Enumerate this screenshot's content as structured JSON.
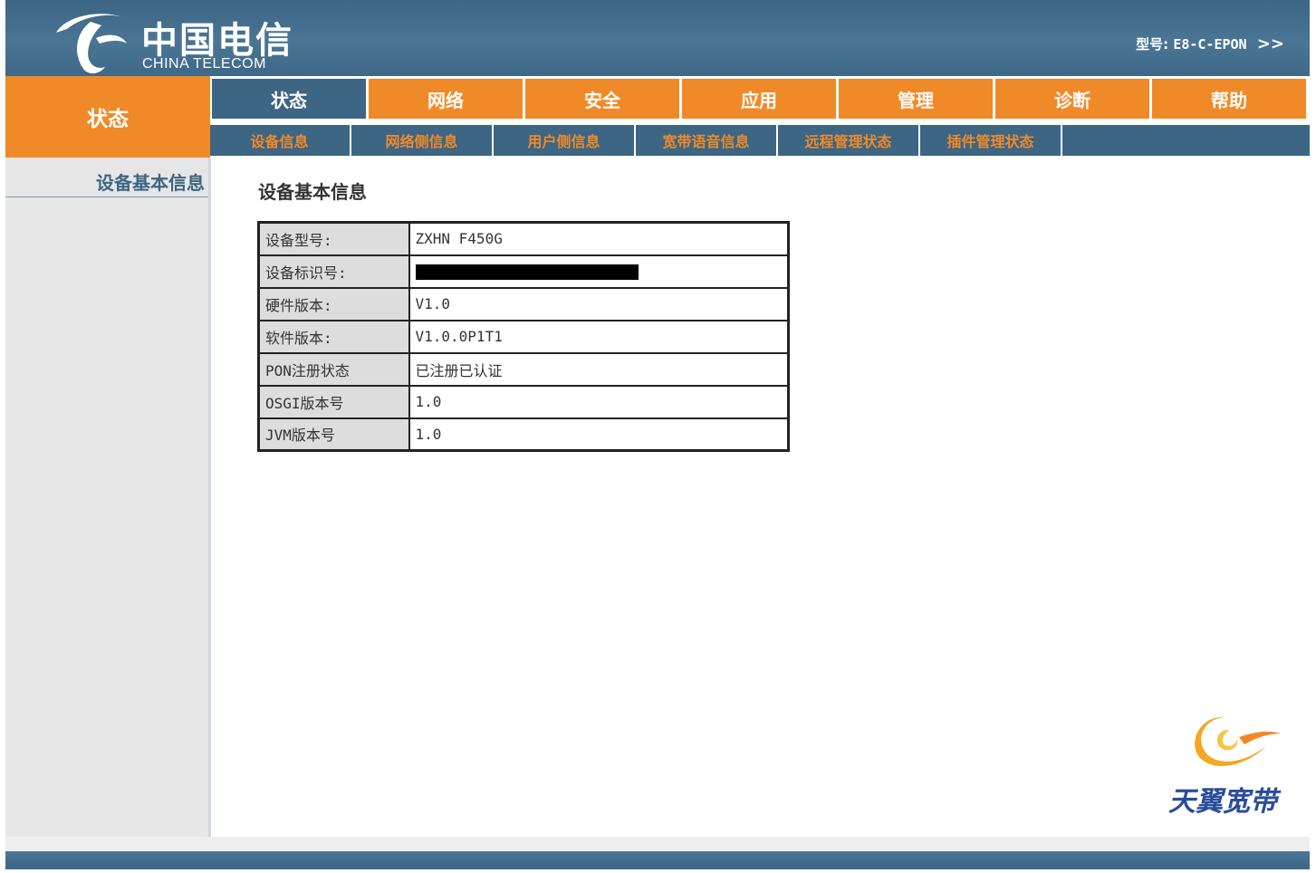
{
  "header": {
    "logo_cn": "中国电信",
    "logo_en": "CHINA TELECOM",
    "model_label": "型号:",
    "model_value": "E8-C-EPON",
    "model_arrow": ">>"
  },
  "section_title": "状态",
  "main_nav": [
    {
      "label": "状态",
      "active": true
    },
    {
      "label": "网络"
    },
    {
      "label": "安全"
    },
    {
      "label": "应用"
    },
    {
      "label": "管理"
    },
    {
      "label": "诊断"
    },
    {
      "label": "帮助"
    }
  ],
  "sub_nav": [
    {
      "label": "设备信息"
    },
    {
      "label": "网络侧信息"
    },
    {
      "label": "用户侧信息"
    },
    {
      "label": "宽带语音信息"
    },
    {
      "label": "远程管理状态"
    },
    {
      "label": "插件管理状态"
    }
  ],
  "sidebar": {
    "items": [
      {
        "label": "设备基本信息"
      }
    ]
  },
  "main": {
    "title": "设备基本信息",
    "rows": [
      {
        "key": "设备型号:",
        "value": "ZXHN F450G"
      },
      {
        "key": "设备标识号:",
        "value": "",
        "redacted": true
      },
      {
        "key": "硬件版本:",
        "value": "V1.0"
      },
      {
        "key": "软件版本:",
        "value": "V1.0.0P1T1"
      },
      {
        "key": "PON注册状态",
        "value": "已注册已认证"
      },
      {
        "key": "OSGI版本号",
        "value": "1.0"
      },
      {
        "key": "JVM版本号",
        "value": "1.0"
      }
    ]
  },
  "brand": {
    "text": "天翼宽带"
  },
  "colors": {
    "blue": "#3d6584",
    "orange": "#f08a28",
    "sidebar": "#e6e6e6"
  },
  "icons": {
    "logo": "china-telecom-logo",
    "brand": "tianyi-swirl-icon"
  }
}
